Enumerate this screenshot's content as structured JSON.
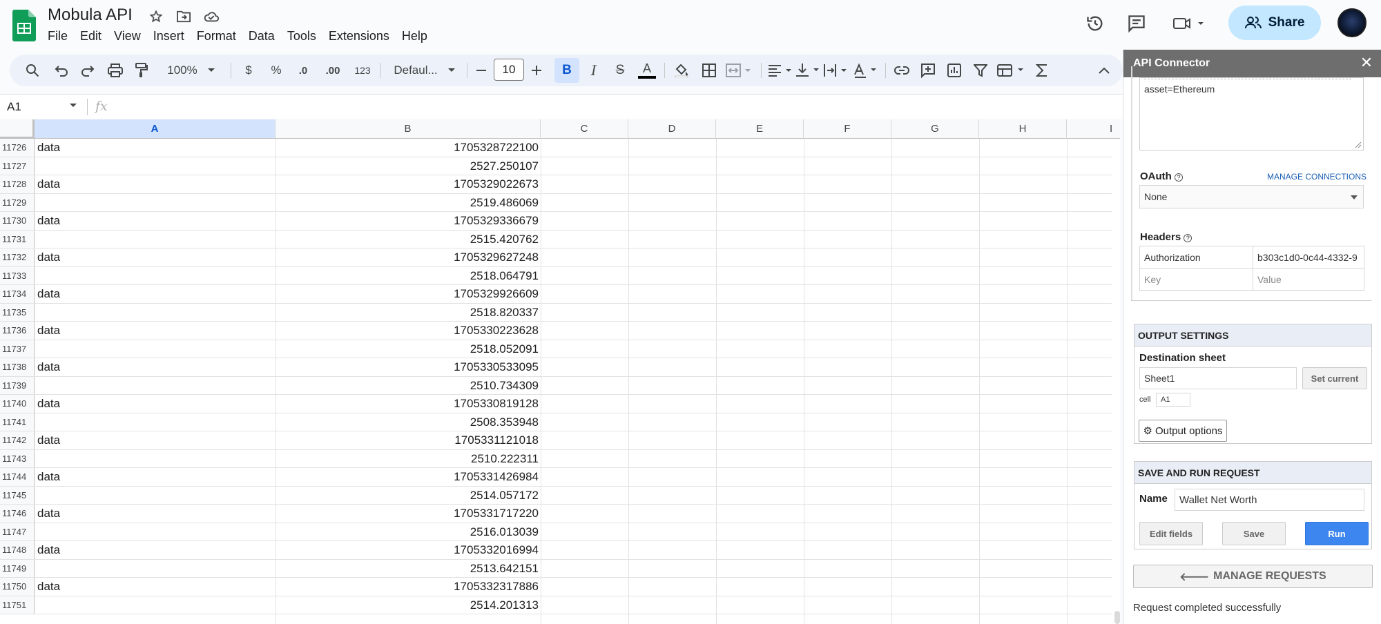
{
  "app": {
    "doc_title": "Mobula API",
    "menu": [
      "File",
      "Edit",
      "View",
      "Insert",
      "Format",
      "Data",
      "Tools",
      "Extensions",
      "Help"
    ],
    "share_label": "Share"
  },
  "toolbar": {
    "zoom": "100%",
    "currency": "$",
    "percent": "%",
    "dec_decrease": ".0",
    "dec_increase": ".00",
    "number_format": "123",
    "font": "Defaul...",
    "font_size": "10",
    "bold": "B",
    "italic": "I",
    "strike": "S",
    "text_color": "A"
  },
  "formula_bar": {
    "cell_ref": "A1",
    "fx": "fx",
    "value": ""
  },
  "columns": [
    "A",
    "B",
    "C",
    "D",
    "E",
    "F",
    "G",
    "H",
    "I"
  ],
  "rows": [
    {
      "num": "11726",
      "a": "data",
      "b": "1705328722100"
    },
    {
      "num": "11727",
      "a": "",
      "b": "2527.250107"
    },
    {
      "num": "11728",
      "a": "data",
      "b": "1705329022673"
    },
    {
      "num": "11729",
      "a": "",
      "b": "2519.486069"
    },
    {
      "num": "11730",
      "a": "data",
      "b": "1705329336679"
    },
    {
      "num": "11731",
      "a": "",
      "b": "2515.420762"
    },
    {
      "num": "11732",
      "a": "data",
      "b": "1705329627248"
    },
    {
      "num": "11733",
      "a": "",
      "b": "2518.064791"
    },
    {
      "num": "11734",
      "a": "data",
      "b": "1705329926609"
    },
    {
      "num": "11735",
      "a": "",
      "b": "2518.820337"
    },
    {
      "num": "11736",
      "a": "data",
      "b": "1705330223628"
    },
    {
      "num": "11737",
      "a": "",
      "b": "2518.052091"
    },
    {
      "num": "11738",
      "a": "data",
      "b": "1705330533095"
    },
    {
      "num": "11739",
      "a": "",
      "b": "2510.734309"
    },
    {
      "num": "11740",
      "a": "data",
      "b": "1705330819128"
    },
    {
      "num": "11741",
      "a": "",
      "b": "2508.353948"
    },
    {
      "num": "11742",
      "a": "data",
      "b": "1705331121018"
    },
    {
      "num": "11743",
      "a": "",
      "b": "2510.222311"
    },
    {
      "num": "11744",
      "a": "data",
      "b": "1705331426984"
    },
    {
      "num": "11745",
      "a": "",
      "b": "2514.057172"
    },
    {
      "num": "11746",
      "a": "data",
      "b": "1705331717220"
    },
    {
      "num": "11747",
      "a": "",
      "b": "2516.013039"
    },
    {
      "num": "11748",
      "a": "data",
      "b": "1705332016994"
    },
    {
      "num": "11749",
      "a": "",
      "b": "2513.642151"
    },
    {
      "num": "11750",
      "a": "data",
      "b": "1705332317886"
    },
    {
      "num": "11751",
      "a": "",
      "b": "2514.201313"
    }
  ],
  "panel": {
    "title": "API Connector",
    "url_tail": "asset=Ethereum",
    "oauth_label": "OAuth",
    "manage_connections": "MANAGE CONNECTIONS",
    "oauth_value": "None",
    "headers_label": "Headers",
    "header_key": "Authorization",
    "header_value": "b303c1d0-0c44-4332-9",
    "key_placeholder": "Key",
    "value_placeholder": "Value",
    "output_settings": "OUTPUT SETTINGS",
    "destination_label": "Destination sheet",
    "destination_value": "Sheet1",
    "set_current": "Set current",
    "cell_label": "cell",
    "cell_value": "A1",
    "output_options": "Output options",
    "save_run_head": "SAVE AND RUN REQUEST",
    "name_label": "Name",
    "name_value": "Wallet Net Worth",
    "edit_fields": "Edit fields",
    "save": "Save",
    "run": "Run",
    "manage_requests": "MANAGE REQUESTS",
    "status": "Request completed successfully"
  }
}
